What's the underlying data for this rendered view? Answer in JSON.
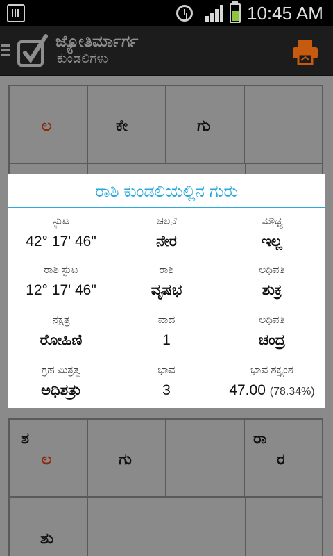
{
  "status_bar": {
    "time": "10:45 AM"
  },
  "app_bar": {
    "title": "ಜ್ಯೋತಿರ್ಮಾರ್ಗ",
    "subtitle": "ಕುಂಡಲಿಗಳು",
    "menu_icon": "menu-icon",
    "print_icon": "printer-icon"
  },
  "chart_top": {
    "cells": [
      "ಲ",
      "ಕೇ",
      "ಗು",
      ""
    ]
  },
  "chart_bottom": {
    "cell_1": [
      "ಶ",
      "ಲ"
    ],
    "cell_2": "ಗು",
    "cell_4": [
      "ರಾ",
      "ರ"
    ],
    "cell_5": "ಶು"
  },
  "dialog": {
    "title": "ರಾಶಿ ಕುಂಡಲಿಯಲ್ಲಿನ ಗುರು",
    "rows": [
      [
        {
          "label": "ಸ್ಫುಟ",
          "value": "42° 17' 46\""
        },
        {
          "label": "ಚಲನೆ",
          "value": "ನೇರ"
        },
        {
          "label": "ಮೌಢ್ಯ",
          "value": "ಇಲ್ಲ"
        }
      ],
      [
        {
          "label": "ರಾಶಿ ಸ್ಫುಟ",
          "value": "12° 17' 46\""
        },
        {
          "label": "ರಾಶಿ",
          "value": "ವೃಷಭ"
        },
        {
          "label": "ಅಧಿಪತಿ",
          "value": "ಶುಕ್ರ"
        }
      ],
      [
        {
          "label": "ನಕ್ಷತ್ರ",
          "value": "ರೋಹಿಣಿ"
        },
        {
          "label": "ಪಾದ",
          "value": "1"
        },
        {
          "label": "ಅಧಿಪತಿ",
          "value": "ಚಂದ್ರ"
        }
      ],
      [
        {
          "label": "ಗ್ರಹ ಮಿತ್ರತ್ವ",
          "value": "ಅಧಿಶತ್ರು"
        },
        {
          "label": "ಭಾವ",
          "value": "3"
        },
        {
          "label": "ಭಾವ ಶಕ್ತ್ಯಂಶ",
          "value": "47.00",
          "extra": "(78.34%)"
        }
      ]
    ]
  },
  "colors": {
    "accent": "#29a9db",
    "planet_red": "#8b2a10",
    "overlay": "#8a8a8a"
  }
}
